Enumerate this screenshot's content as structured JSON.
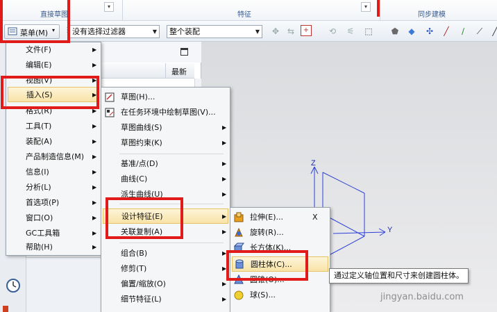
{
  "ribbon": {
    "groups": [
      {
        "label": "直接草图"
      },
      {
        "label": "特征"
      },
      {
        "label": "同步建模"
      }
    ]
  },
  "toolbar": {
    "menu_button_label": "菜单(M)",
    "filter_combo_value": "没有选择过滤器",
    "assembly_combo_value": "整个装配"
  },
  "panel": {
    "column_newest": "最新"
  },
  "main_menu": {
    "items": [
      {
        "label": "文件(F)",
        "has_sub": true
      },
      {
        "label": "编辑(E)",
        "has_sub": true
      },
      {
        "label": "视图(V)",
        "has_sub": true
      },
      {
        "label": "插入(S)",
        "has_sub": true
      },
      {
        "label": "格式(R)",
        "has_sub": true
      },
      {
        "label": "工具(T)",
        "has_sub": true
      },
      {
        "label": "装配(A)",
        "has_sub": true
      },
      {
        "label": "产品制造信息(M)",
        "has_sub": true
      },
      {
        "label": "信息(I)",
        "has_sub": true
      },
      {
        "label": "分析(L)",
        "has_sub": true
      },
      {
        "label": "首选项(P)",
        "has_sub": true
      },
      {
        "label": "窗口(O)",
        "has_sub": true
      },
      {
        "label": "GC工具箱",
        "has_sub": true
      },
      {
        "label": "帮助(H)",
        "has_sub": true
      }
    ]
  },
  "insert_menu": {
    "items": [
      {
        "label": "草图(H)..."
      },
      {
        "label": "在任务环境中绘制草图(V)..."
      },
      {
        "label": "草图曲线(S)"
      },
      {
        "label": "草图约束(K)"
      },
      {
        "label": "基准/点(D)"
      },
      {
        "label": "曲线(C)"
      },
      {
        "label": "派生曲线(U)"
      },
      {
        "label": "设计特征(E)"
      },
      {
        "label": "关联复制(A)"
      },
      {
        "label": "组合(B)"
      },
      {
        "label": "修剪(T)"
      },
      {
        "label": "偏置/缩放(O)"
      },
      {
        "label": "细节特征(L)"
      }
    ]
  },
  "design_feature_menu": {
    "items": [
      {
        "label": "拉伸(E)...",
        "shortcut": "X"
      },
      {
        "label": "旋转(R)..."
      },
      {
        "label": "长方体(K)..."
      },
      {
        "label": "圆柱体(C)..."
      },
      {
        "label": "圆锥(O)..."
      },
      {
        "label": "球(S)..."
      }
    ]
  },
  "tooltip": {
    "text": "通过定义轴位置和尺寸来创建圆柱体。"
  },
  "viewport": {
    "axis_z": "Z",
    "axis_y": "Y"
  },
  "watermark": {
    "text": "jingyan.baidu.com"
  },
  "colors": {
    "highlight_box": "#e11a1a",
    "menu_hover": "#f8e3a7",
    "axis": "#2b3fd8"
  }
}
